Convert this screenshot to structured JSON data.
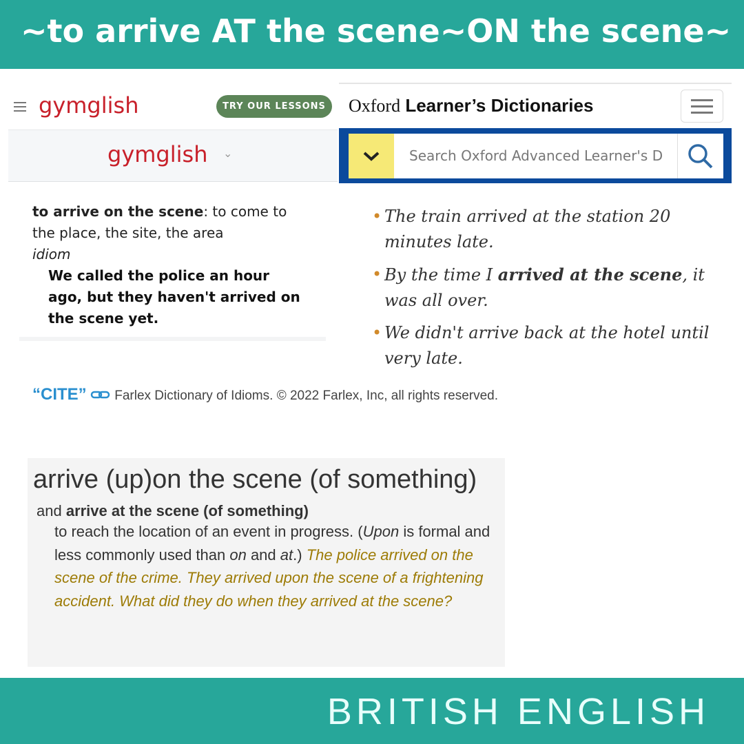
{
  "banner": {
    "title": "~to arrive AT the scene~ON the scene~",
    "footer": "BRITISH ENGLISH"
  },
  "gymglish": {
    "logo": "gymglish",
    "cta": "TRY OUR LESSONS",
    "sub_logo": "gymglish",
    "term": "to arrive on the scene",
    "definition": ": to come to the place, the site, the area",
    "type": "idiom",
    "example": "We called the police an hour ago, but they haven't arrived on the scene yet."
  },
  "oxford": {
    "logo_a": "Oxford",
    "logo_b": "Learner’s Dictionaries",
    "search_placeholder": "Search Oxford Advanced Learner's D",
    "examples": [
      {
        "pre": "The train arrived at the station 20 minutes late.",
        "bold": "",
        "post": ""
      },
      {
        "pre": "By the time I ",
        "bold": "arrived at the scene",
        "post": ", it was all over."
      },
      {
        "pre": "We didn't arrive back at the hotel until very late.",
        "bold": "",
        "post": ""
      }
    ]
  },
  "cite": {
    "label": "“CITE”",
    "text": "Farlex Dictionary of Idioms. © 2022 Farlex, Inc, all rights reserved."
  },
  "farlex": {
    "headword": "arrive (up)on the scene (of something)",
    "and": "and ",
    "variant": "arrive at the scene (of something)",
    "def1": "to reach the location of an event in progress. (",
    "upon": "Upon",
    "def2": " is formal and less commonly used than ",
    "on": "on",
    "def3": " and ",
    "at": "at",
    "def4": ".) ",
    "examples": "The police arrived on the scene of the crime. They arrived upon the scene of a frightening accident. What did they do when they arrived at the scene?"
  },
  "colors": {
    "teal": "#27a79a",
    "gym_red": "#c8202a",
    "oxford_blue": "#0b4a9c",
    "yellow": "#f6e976",
    "gold": "#9d7b06"
  }
}
